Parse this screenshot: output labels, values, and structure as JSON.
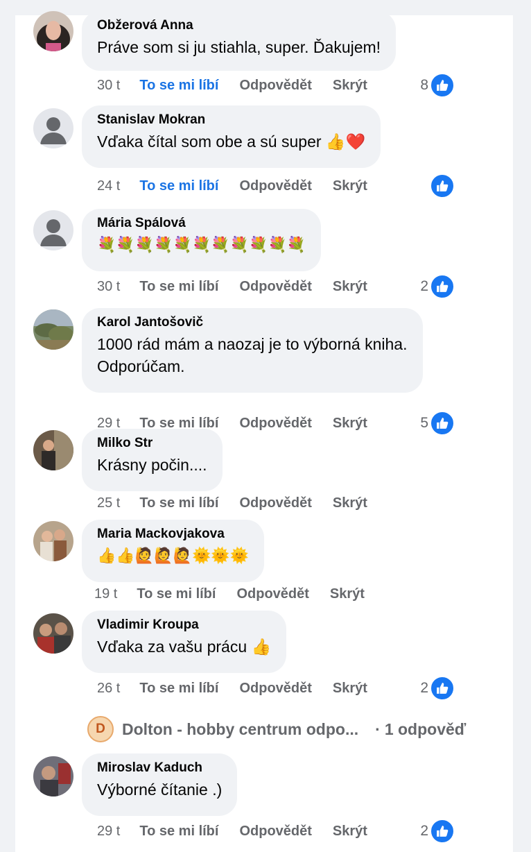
{
  "actions": {
    "like": "To se mi líbí",
    "reply": "Odpovědět",
    "hide": "Skrýt"
  },
  "colors": {
    "accent": "#1b74e4",
    "like_badge": "#1877f2",
    "bubble": "#f0f2f5",
    "muted": "#65676b"
  },
  "comments": [
    {
      "author": "Obžerová Anna",
      "text": "Práve som si ju stiahla, super. Ďakujem!",
      "time": "30 t",
      "liked": true,
      "reaction_count": "8",
      "avatar": "photo-woman-dark-hair"
    },
    {
      "author": "Stanislav Mokran",
      "text": "Vďaka čítal som obe a sú super 👍❤️",
      "time": "24 t",
      "liked": true,
      "reaction_count": "",
      "avatar": "default-person-icon"
    },
    {
      "author": "Mária Spálová",
      "text": "💐💐💐💐💐💐💐💐💐💐💐",
      "time": "30 t",
      "liked": false,
      "reaction_count": "2",
      "avatar": "default-person-icon"
    },
    {
      "author": "Karol Jantošovič",
      "text": "1000 rád mám a naozaj je to výborná kniha.\nOdporúčam.",
      "time": "29 t",
      "liked": false,
      "reaction_count": "5",
      "avatar": "photo-landscape"
    },
    {
      "author": "Milko Str",
      "text": "Krásny počin....",
      "time": "25 t",
      "liked": false,
      "reaction_count": "",
      "avatar": "photo-man-indoor"
    },
    {
      "author": "Maria Mackovjakova",
      "text": "👍👍🙋🙋🙋🌞🌞🌞",
      "time": "19 t",
      "liked": false,
      "reaction_count": "",
      "avatar": "photo-couple"
    },
    {
      "author": "Vladimir Kroupa",
      "text": "Vďaka za vašu prácu 👍",
      "time": "26 t",
      "liked": false,
      "reaction_count": "2",
      "avatar": "photo-group"
    },
    {
      "author": "Miroslav Kaduch",
      "text": "Výborné čítanie .)",
      "time": "29 t",
      "liked": false,
      "reaction_count": "2",
      "avatar": "photo-man-outdoor"
    }
  ],
  "reply_thread": {
    "page_initial": "D",
    "page_name": "Dolton - hobby centrum odpo...",
    "separator": "·",
    "count_label": "1 odpověď"
  }
}
